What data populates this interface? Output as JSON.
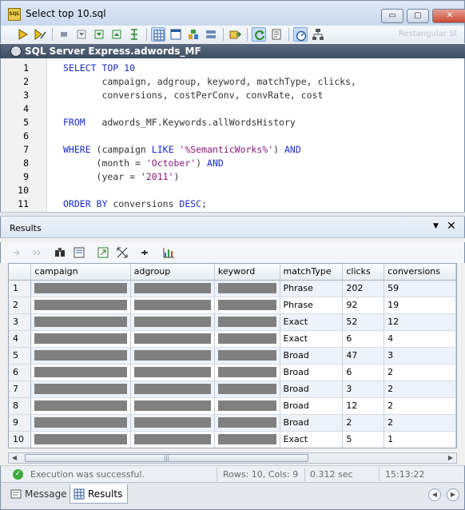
{
  "window": {
    "title": "Select top 10.sql",
    "icon_label": "SQL",
    "minimize_glyph": "▭",
    "maximize_glyph": "▢",
    "close_glyph": "✕"
  },
  "toolbar": {
    "ghost_text": "Restangular St",
    "icons": [
      "execute-icon",
      "execute-step-icon",
      "stop-icon",
      "collapse-icon",
      "expand-icon",
      "format-icon",
      "result-grid-icon",
      "result-text-icon",
      "tree-icon",
      "compare-icon",
      "import-icon",
      "refresh-icon",
      "properties-icon",
      "stopwatch-icon",
      "connect-icon"
    ]
  },
  "connection": {
    "label": "SQL Server Express.adwords_MF"
  },
  "editor": {
    "lines": [
      {
        "n": "1",
        "tokens": [
          {
            "t": "SELECT TOP 10",
            "c": "kw"
          }
        ]
      },
      {
        "n": "2",
        "tokens": [
          {
            "t": "       campaign, adgroup, keyword, matchType, clicks,",
            "c": "ident"
          }
        ]
      },
      {
        "n": "3",
        "tokens": [
          {
            "t": "       conversions, costPerConv, convRate, cost",
            "c": "ident"
          }
        ]
      },
      {
        "n": "4",
        "tokens": []
      },
      {
        "n": "5",
        "tokens": [
          {
            "t": "FROM",
            "c": "kw"
          },
          {
            "t": "   adwords_MF.Keywords.allWordsHistory",
            "c": "ident"
          }
        ]
      },
      {
        "n": "6",
        "tokens": []
      },
      {
        "n": "7",
        "tokens": [
          {
            "t": "WHERE",
            "c": "kw"
          },
          {
            "t": " (campaign ",
            "c": "ident"
          },
          {
            "t": "LIKE",
            "c": "kw"
          },
          {
            "t": " '%SemanticWorks%'",
            "c": "str"
          },
          {
            "t": ") ",
            "c": "ident"
          },
          {
            "t": "AND",
            "c": "kw"
          }
        ]
      },
      {
        "n": "8",
        "tokens": [
          {
            "t": "      (month = ",
            "c": "ident"
          },
          {
            "t": "'October'",
            "c": "str"
          },
          {
            "t": ") ",
            "c": "ident"
          },
          {
            "t": "AND",
            "c": "kw"
          }
        ]
      },
      {
        "n": "9",
        "tokens": [
          {
            "t": "      (year = ",
            "c": "ident"
          },
          {
            "t": "'2011'",
            "c": "str"
          },
          {
            "t": ")",
            "c": "ident"
          }
        ]
      },
      {
        "n": "10",
        "tokens": []
      },
      {
        "n": "11",
        "tokens": [
          {
            "t": "ORDER BY",
            "c": "kw"
          },
          {
            "t": " conversions ",
            "c": "ident"
          },
          {
            "t": "DESC",
            "c": "kw"
          },
          {
            "t": ";",
            "c": "ident"
          }
        ]
      }
    ]
  },
  "results": {
    "title": "Results",
    "pin_glyph": "▼",
    "close_glyph": "✕",
    "columns": [
      "campaign",
      "adgroup",
      "keyword",
      "matchType",
      "clicks",
      "conversions"
    ],
    "rows": [
      {
        "n": "1",
        "matchType": "Phrase",
        "clicks": "202",
        "conversions": "59"
      },
      {
        "n": "2",
        "matchType": "Phrase",
        "clicks": "92",
        "conversions": "19"
      },
      {
        "n": "3",
        "matchType": "Exact",
        "clicks": "52",
        "conversions": "12"
      },
      {
        "n": "4",
        "matchType": "Exact",
        "clicks": "6",
        "conversions": "4"
      },
      {
        "n": "5",
        "matchType": "Broad",
        "clicks": "47",
        "conversions": "3"
      },
      {
        "n": "6",
        "matchType": "Broad",
        "clicks": "6",
        "conversions": "2"
      },
      {
        "n": "7",
        "matchType": "Broad",
        "clicks": "3",
        "conversions": "2"
      },
      {
        "n": "8",
        "matchType": "Broad",
        "clicks": "12",
        "conversions": "2"
      },
      {
        "n": "9",
        "matchType": "Broad",
        "clicks": "2",
        "conversions": "2"
      },
      {
        "n": "10",
        "matchType": "Exact",
        "clicks": "5",
        "conversions": "1"
      }
    ],
    "scrollbar_grip": "|||",
    "scroll_left_glyph": "◀",
    "scroll_right_glyph": "▶"
  },
  "status": {
    "message": "Execution was successful.",
    "ok_glyph": "✓",
    "rows_cols": "Rows: 10, Cols: 9",
    "duration": "0.312 sec",
    "time": "15:13:22"
  },
  "tabs": [
    {
      "label": "Message",
      "active": false
    },
    {
      "label": "Results",
      "active": true
    }
  ],
  "nav": {
    "prev_glyph": "◀",
    "next_glyph": "▶"
  },
  "colors": {
    "keyword": "#1b2cc8",
    "string": "#8a1a7a",
    "connection_bar": "#4a586c",
    "success": "#3caa3c"
  }
}
